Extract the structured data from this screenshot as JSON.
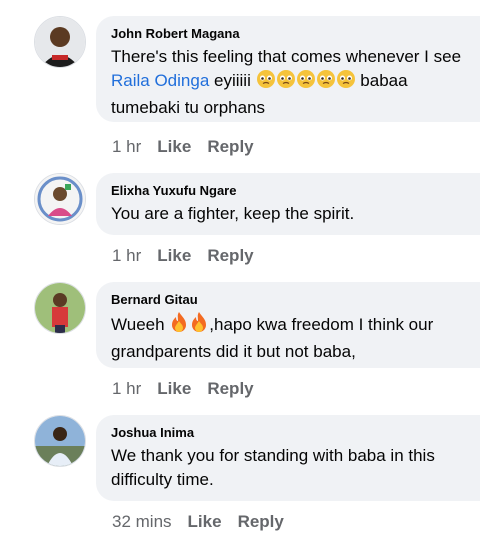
{
  "comments": [
    {
      "author": "John Robert Magana",
      "line1": "There's this feeling that comes whenever I see",
      "mention": "Raila Odinga",
      "line2_text": " eyiiiii",
      "line2_end": " babaa",
      "line3": "tumebaki tu orphans",
      "emoji": "pleading-face",
      "time": "1 hr",
      "like": "Like",
      "reply": "Reply"
    },
    {
      "author": "Elixha Yuxufu Ngare",
      "line1": "You are a fighter, keep the spirit.",
      "time": "1 hr",
      "like": "Like",
      "reply": "Reply"
    },
    {
      "author": "Bernard Gitau",
      "line1_start": "Wueeh ",
      "line1_end": ",hapo kwa freedom I think our",
      "line2": "grandparents did it but not baba,",
      "emoji": "fire",
      "time": "1 hr",
      "like": "Like",
      "reply": "Reply"
    },
    {
      "author": "Joshua Inima",
      "line1": "We thank you for standing with baba in this",
      "line2": "difficulty time.",
      "time": "32 mins",
      "like": "Like",
      "reply": "Reply"
    }
  ],
  "colors": {
    "bubble": "#f0f2f5",
    "mention": "#216fdb",
    "meta": "#65676b"
  }
}
